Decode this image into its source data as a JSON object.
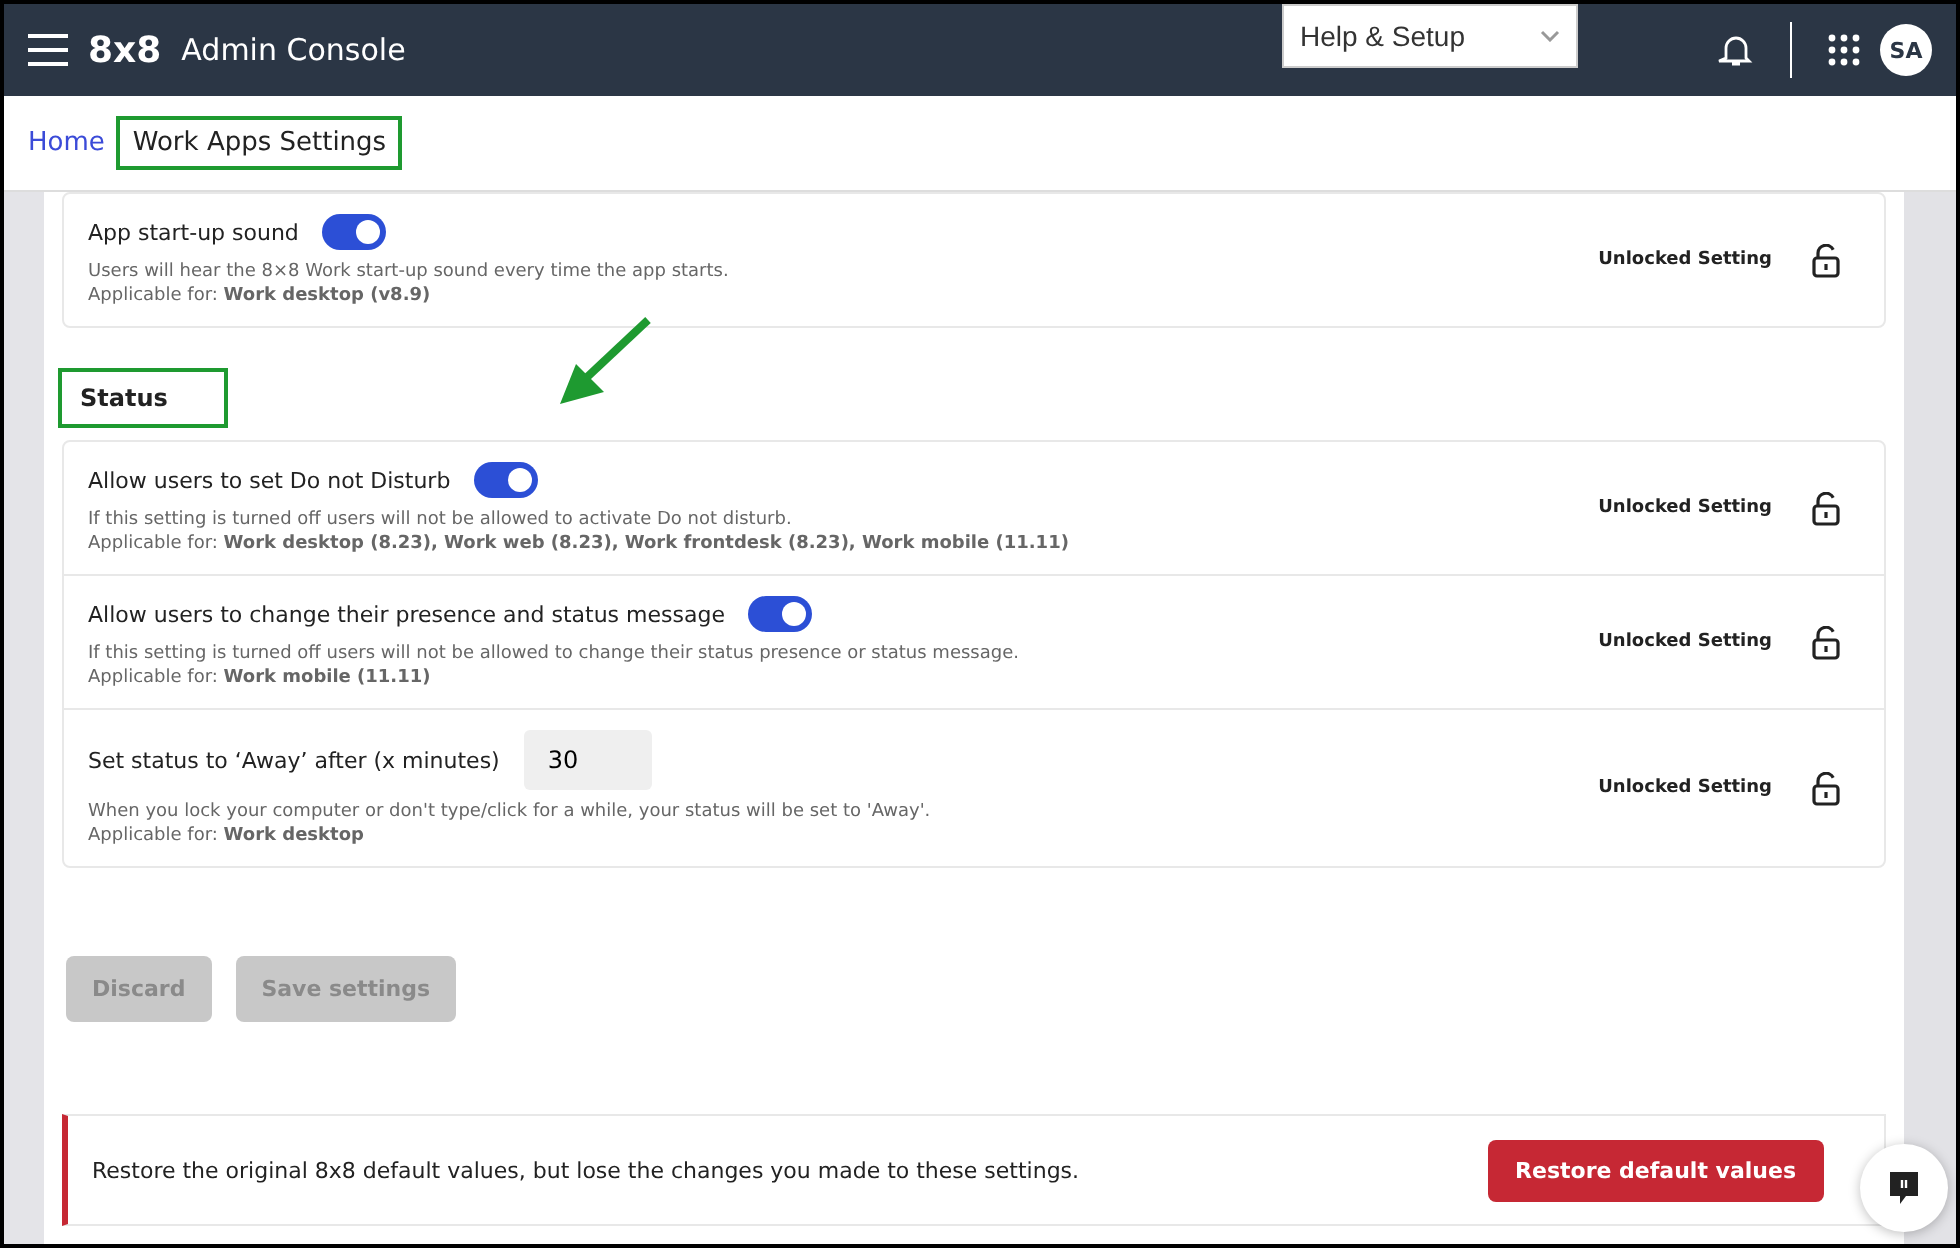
{
  "header": {
    "logo": "8x8",
    "title": "Admin Console",
    "help_menu": "Help & Setup",
    "avatar": "SA"
  },
  "breadcrumb": [
    {
      "label": "Home",
      "selected": false
    },
    {
      "label": "Work Apps Settings",
      "selected": true
    }
  ],
  "top_card": {
    "title": "App start-up sound",
    "on": true,
    "description": "Users will hear the 8×8 Work start-up sound every time the app starts.",
    "applicable": "Applicable for: **Work desktop (v8.9)**",
    "lock_label": "Unlocked Setting"
  },
  "section": {
    "title": "Status",
    "settings": [
      {
        "kind": "toggle",
        "title": "Allow users to set Do not Disturb",
        "on": true,
        "description": "If this setting is turned off users will not be allowed to activate Do not disturb.",
        "applicable": "Applicable for: **Work desktop (8.23), Work web (8.23), Work frontdesk (8.23), Work mobile (11.11)**",
        "lock_label": "Unlocked Setting"
      },
      {
        "kind": "toggle",
        "title": "Allow users to change their presence and status message",
        "on": true,
        "description": "If this setting is turned off users will not be allowed to change their status presence or status message.",
        "applicable": "Applicable for: **Work mobile (11.11)**",
        "lock_label": "Unlocked Setting"
      },
      {
        "kind": "number",
        "title": "Set status to ‘Away’ after (x minutes)",
        "value": "30",
        "description": "When you lock your computer or don't type/click for a while, your status will be set to 'Away'.",
        "applicable": "Applicable for: **Work desktop**",
        "lock_label": "Unlocked Setting"
      }
    ]
  },
  "buttons": [
    {
      "label": "Discard",
      "disabled": true
    },
    {
      "label": "Save settings",
      "disabled": true
    }
  ],
  "restore": {
    "message": "Restore the original 8x8 default values, but lose the changes you made to these settings.",
    "button": "Restore default values"
  }
}
